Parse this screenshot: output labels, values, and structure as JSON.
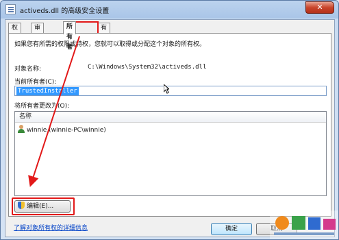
{
  "window": {
    "title": "activeds.dll 的高级安全设置",
    "close_glyph": "✕"
  },
  "tabs": [
    {
      "label": "权限"
    },
    {
      "label": "审核"
    },
    {
      "label": "所有者"
    },
    {
      "label": "有效权限"
    }
  ],
  "owner_page": {
    "intro": "如果您有所需的权限或特权，您就可以取得或分配这个对象的所有权。",
    "object_name_label": "对象名称:",
    "object_name_value": "C:\\Windows\\System32\\activeds.dll",
    "current_owner_label": "当前所有者(C):",
    "current_owner_value": "TrustedInstaller",
    "change_owner_label": "将所有者更改为(O):",
    "list_header": "名称",
    "list_items": [
      {
        "label": "winnie (winnie-PC\\winnie)"
      }
    ],
    "edit_button": "编辑(E)...",
    "learn_link": "了解对象所有权的详细信息"
  },
  "footer": {
    "ok_label": "确定",
    "cancel_label": "取消"
  },
  "colors": {
    "highlight": "#e21818",
    "link": "#0645c8",
    "selection": "#3399ff"
  }
}
